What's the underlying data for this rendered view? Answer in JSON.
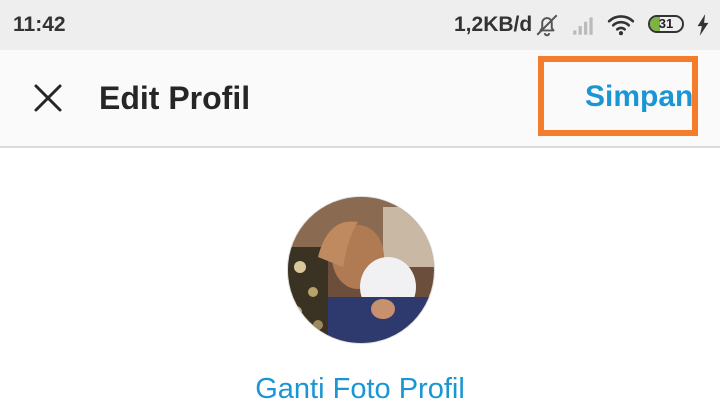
{
  "status_bar": {
    "time": "11:42",
    "network_speed": "1,2KB/d",
    "battery_level": "31",
    "battery_fraction": 0.31,
    "icons": [
      "bell-off-icon",
      "signal-icon",
      "wifi-icon",
      "battery-icon",
      "charging-icon"
    ]
  },
  "header": {
    "close_icon": "close-icon",
    "title": "Edit Profil",
    "save_label": "Simpan"
  },
  "profile": {
    "change_photo_label": "Ganti Foto Profil"
  },
  "colors": {
    "accent": "#1a96d4",
    "highlight": "#f47c2b",
    "battery": "#7cb342"
  }
}
